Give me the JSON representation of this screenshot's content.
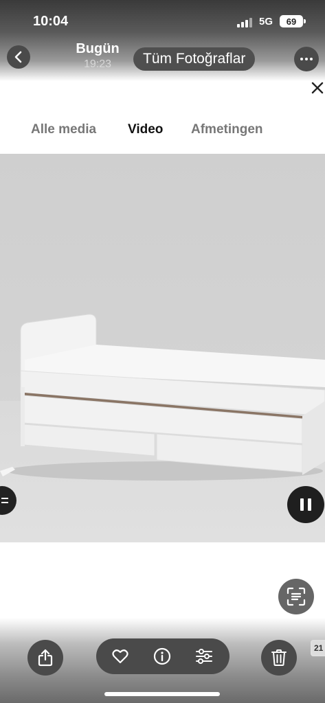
{
  "status_bar": {
    "time": "10:04",
    "network": "5G",
    "battery": "69"
  },
  "photo_nav": {
    "title": "Bugün",
    "subtitle": "19:23",
    "all_photos_label": "Tüm Fotoğraflar"
  },
  "tabs": [
    {
      "label": "Alle media",
      "active": false
    },
    {
      "label": "Video",
      "active": true
    },
    {
      "label": "Afmetingen",
      "active": false
    }
  ],
  "corner_badge": "21",
  "icons": {
    "back": "chevron-left-icon",
    "more": "ellipsis-icon",
    "close": "close-icon",
    "pause": "pause-icon",
    "scan": "text-scan-icon",
    "share": "share-icon",
    "favorite": "heart-icon",
    "info": "info-icon",
    "adjust": "sliders-icon",
    "delete": "trash-icon"
  },
  "colors": {
    "chrome_button": "#4a4a4a",
    "media_background": "#d0d0d0",
    "bed_white": "#f4f4f4",
    "stripe": "#8a7565"
  }
}
